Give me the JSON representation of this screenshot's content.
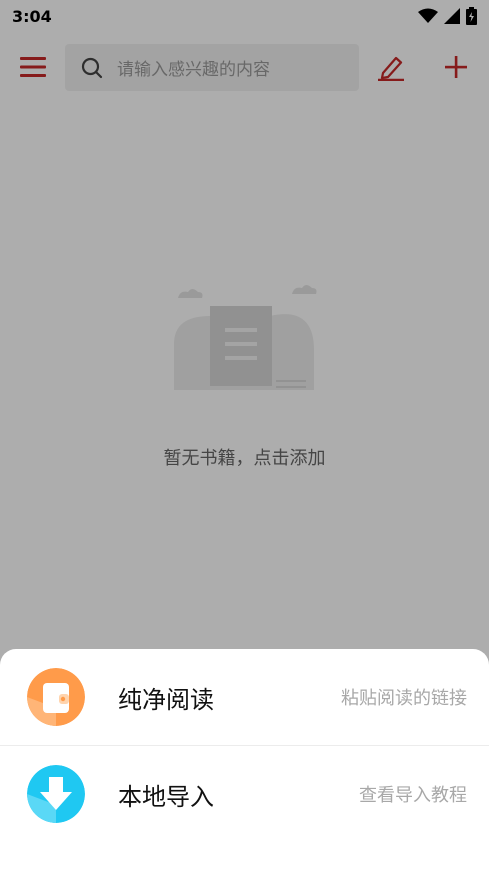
{
  "status_bar": {
    "time": "3:04",
    "icons": [
      "wifi-icon",
      "signal-icon",
      "battery-icon"
    ]
  },
  "toolbar": {
    "menu_icon": "menu-icon",
    "search_placeholder": "请输入感兴趣的内容",
    "edit_icon": "edit-icon",
    "add_icon": "add-icon"
  },
  "empty_state": {
    "message": "暂无书籍，点击添加"
  },
  "sheet": {
    "items": [
      {
        "title": "纯净阅读",
        "hint": "粘贴阅读的链接",
        "icon": "pure-read-icon",
        "color": "#ff9b4a"
      },
      {
        "title": "本地导入",
        "hint": "查看导入教程",
        "icon": "download-icon",
        "color": "#1fc8f2"
      }
    ]
  },
  "colors": {
    "accent": "#c62828",
    "overlay": "rgba(0,0,0,0.32)"
  }
}
